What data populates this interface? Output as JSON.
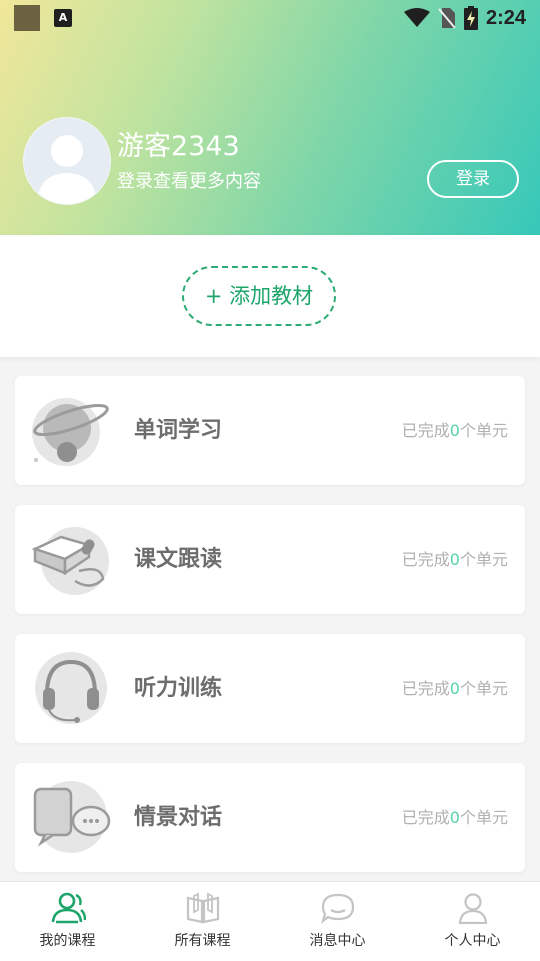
{
  "status_bar": {
    "time": "2:24"
  },
  "header": {
    "username": "游客2343",
    "subtitle": "登录查看更多内容",
    "login_label": "登录"
  },
  "add_material_label": "+ 添加教材",
  "cards": [
    {
      "title": "单词学习",
      "status_prefix": "已完成",
      "count": "0",
      "status_suffix": "个单元",
      "icon": "planet-icon"
    },
    {
      "title": "课文跟读",
      "status_prefix": "已完成",
      "count": "0",
      "status_suffix": "个单元",
      "icon": "book-microphone-icon"
    },
    {
      "title": "听力训练",
      "status_prefix": "已完成",
      "count": "0",
      "status_suffix": "个单元",
      "icon": "headphones-icon"
    },
    {
      "title": "情景对话",
      "status_prefix": "已完成",
      "count": "0",
      "status_suffix": "个单元",
      "icon": "chat-bubbles-icon"
    }
  ],
  "tabs": [
    {
      "label": "我的课程",
      "icon": "users-icon",
      "active": true
    },
    {
      "label": "所有课程",
      "icon": "open-book-icon",
      "active": false
    },
    {
      "label": "消息中心",
      "icon": "message-icon",
      "active": false
    },
    {
      "label": "个人中心",
      "icon": "person-icon",
      "active": false
    }
  ],
  "colors": {
    "accent": "#1ea56a",
    "count": "#56d3a8",
    "inactive_icon": "#c4c4c4"
  }
}
